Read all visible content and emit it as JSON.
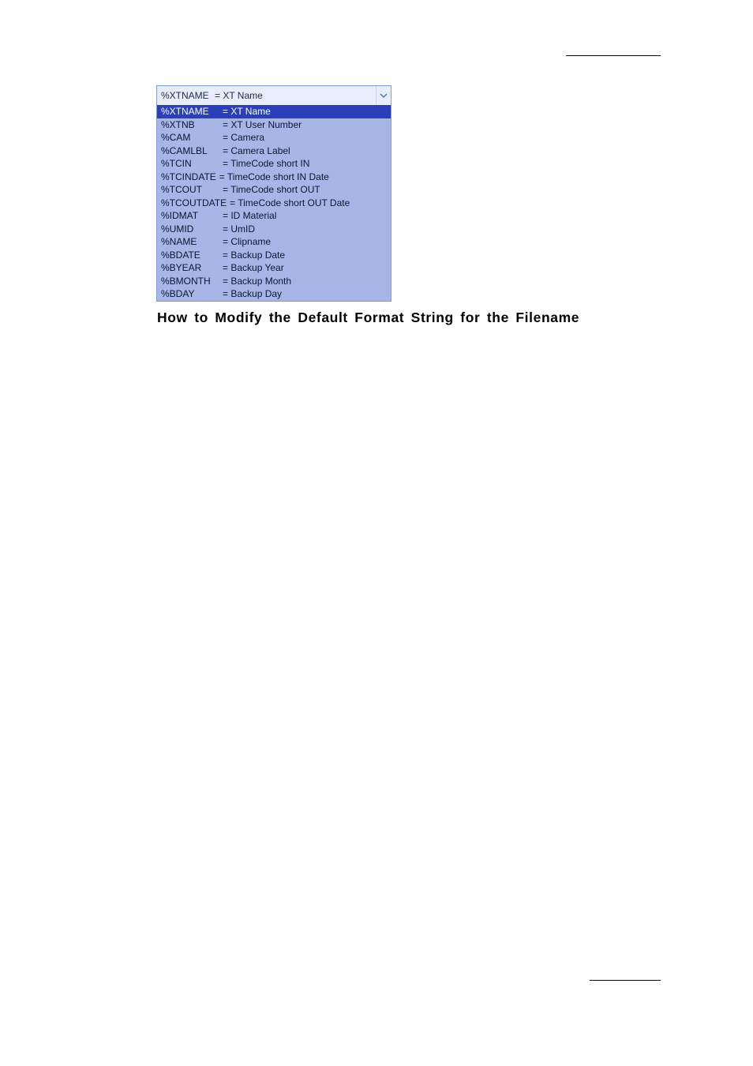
{
  "dropdown": {
    "selected": {
      "code": "%XTNAME",
      "desc": "= XT Name"
    },
    "items": [
      {
        "code": "%XTNAME",
        "desc": "= XT Name"
      },
      {
        "code": "%XTNB",
        "desc": "= XT User Number"
      },
      {
        "code": "%CAM",
        "desc": "= Camera"
      },
      {
        "code": "%CAMLBL",
        "desc": "= Camera Label"
      },
      {
        "code": "%TCIN",
        "desc": "= TimeCode short IN"
      },
      {
        "code": "%TCINDATE",
        "desc": "= TimeCode short IN Date"
      },
      {
        "code": "%TCOUT",
        "desc": "= TimeCode short OUT"
      },
      {
        "code": "%TCOUTDATE",
        "desc": "= TimeCode short OUT Date"
      },
      {
        "code": "%IDMAT",
        "desc": "= ID Material"
      },
      {
        "code": "%UMID",
        "desc": "= UmID"
      },
      {
        "code": "%NAME",
        "desc": "= Clipname"
      },
      {
        "code": "%BDATE",
        "desc": "= Backup Date"
      },
      {
        "code": "%BYEAR",
        "desc": "= Backup Year"
      },
      {
        "code": "%BMONTH",
        "desc": "= Backup Month"
      },
      {
        "code": "%BDAY",
        "desc": "= Backup Day"
      }
    ],
    "wide_indices": [
      5,
      7
    ]
  },
  "heading": "How to Modify the Default Format String for the Filename"
}
